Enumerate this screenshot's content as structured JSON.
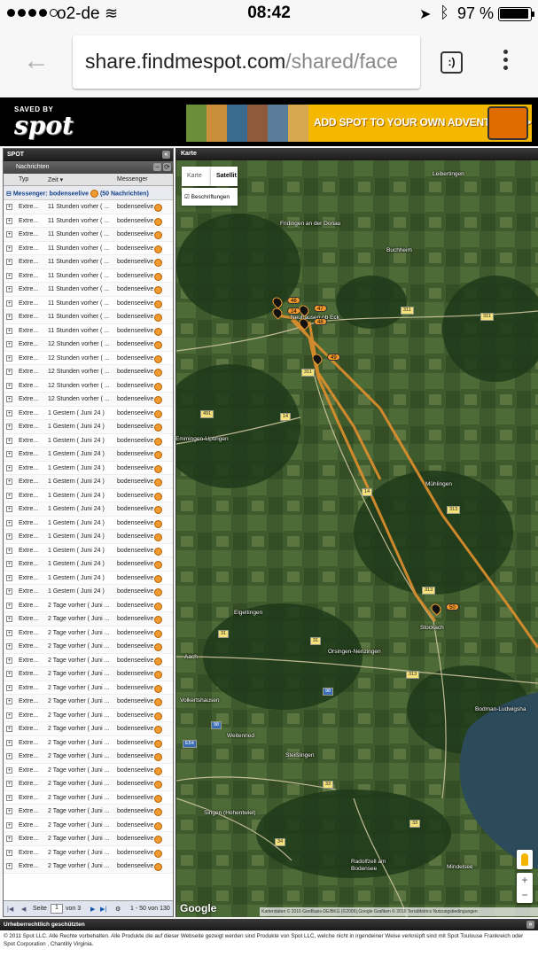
{
  "status_bar": {
    "carrier": "o2-de",
    "time": "08:42",
    "battery_percent": "97 %"
  },
  "browser": {
    "url_host": "share.findmespot.com",
    "url_path": "/shared/face",
    "reader_icon_label": ":)"
  },
  "header": {
    "logo_small": "SAVED BY",
    "logo_big": "spot",
    "ad_text": "ADD SPOT TO YOUR OWN ADVENTURES>>"
  },
  "panel": {
    "title": "SPOT",
    "subtitle": "Nachrichten",
    "columns": {
      "typ": "Typ",
      "zeit": "Zeit",
      "messenger": "Messenger"
    },
    "group_label": "Messenger: bodenseelive",
    "group_count": "(50 Nachrichten)",
    "rows": [
      {
        "typ": "Extre...",
        "zeit": "11 Stunden vorher ( ...",
        "messenger": "bodenseelive"
      },
      {
        "typ": "Extre...",
        "zeit": "11 Stunden vorher ( ...",
        "messenger": "bodenseelive"
      },
      {
        "typ": "Extre...",
        "zeit": "11 Stunden vorher ( ...",
        "messenger": "bodenseelive"
      },
      {
        "typ": "Extre...",
        "zeit": "11 Stunden vorher ( ...",
        "messenger": "bodenseelive"
      },
      {
        "typ": "Extre...",
        "zeit": "11 Stunden vorher ( ...",
        "messenger": "bodenseelive"
      },
      {
        "typ": "Extre...",
        "zeit": "11 Stunden vorher ( ...",
        "messenger": "bodenseelive"
      },
      {
        "typ": "Extre...",
        "zeit": "11 Stunden vorher ( ...",
        "messenger": "bodenseelive"
      },
      {
        "typ": "Extre...",
        "zeit": "11 Stunden vorher ( ...",
        "messenger": "bodenseelive"
      },
      {
        "typ": "Extre...",
        "zeit": "11 Stunden vorher ( ...",
        "messenger": "bodenseelive"
      },
      {
        "typ": "Extre...",
        "zeit": "11 Stunden vorher ( ...",
        "messenger": "bodenseelive"
      },
      {
        "typ": "Extre...",
        "zeit": "12 Stunden vorher ( ...",
        "messenger": "bodenseelive"
      },
      {
        "typ": "Extre...",
        "zeit": "12 Stunden vorher ( ...",
        "messenger": "bodenseelive"
      },
      {
        "typ": "Extre...",
        "zeit": "12 Stunden vorher ( ...",
        "messenger": "bodenseelive"
      },
      {
        "typ": "Extre...",
        "zeit": "12 Stunden vorher ( ...",
        "messenger": "bodenseelive"
      },
      {
        "typ": "Extre...",
        "zeit": "12 Stunden vorher ( ...",
        "messenger": "bodenseelive"
      },
      {
        "typ": "Extre...",
        "zeit": "1 Gestern ( Juni 24 )",
        "messenger": "bodenseelive"
      },
      {
        "typ": "Extre...",
        "zeit": "1 Gestern ( Juni 24 )",
        "messenger": "bodenseelive"
      },
      {
        "typ": "Extre...",
        "zeit": "1 Gestern ( Juni 24 )",
        "messenger": "bodenseelive"
      },
      {
        "typ": "Extre...",
        "zeit": "1 Gestern ( Juni 24 )",
        "messenger": "bodenseelive"
      },
      {
        "typ": "Extre...",
        "zeit": "1 Gestern ( Juni 24 )",
        "messenger": "bodenseelive"
      },
      {
        "typ": "Extre...",
        "zeit": "1 Gestern ( Juni 24 )",
        "messenger": "bodenseelive"
      },
      {
        "typ": "Extre...",
        "zeit": "1 Gestern ( Juni 24 )",
        "messenger": "bodenseelive"
      },
      {
        "typ": "Extre...",
        "zeit": "1 Gestern ( Juni 24 )",
        "messenger": "bodenseelive"
      },
      {
        "typ": "Extre...",
        "zeit": "1 Gestern ( Juni 24 )",
        "messenger": "bodenseelive"
      },
      {
        "typ": "Extre...",
        "zeit": "1 Gestern ( Juni 24 )",
        "messenger": "bodenseelive"
      },
      {
        "typ": "Extre...",
        "zeit": "1 Gestern ( Juni 24 )",
        "messenger": "bodenseelive"
      },
      {
        "typ": "Extre...",
        "zeit": "1 Gestern ( Juni 24 )",
        "messenger": "bodenseelive"
      },
      {
        "typ": "Extre...",
        "zeit": "1 Gestern ( Juni 24 )",
        "messenger": "bodenseelive"
      },
      {
        "typ": "Extre...",
        "zeit": "1 Gestern ( Juni 24 )",
        "messenger": "bodenseelive"
      },
      {
        "typ": "Extre...",
        "zeit": "2 Tage vorher ( Juni ...",
        "messenger": "bodenseelive"
      },
      {
        "typ": "Extre...",
        "zeit": "2 Tage vorher ( Juni ...",
        "messenger": "bodenseelive"
      },
      {
        "typ": "Extre...",
        "zeit": "2 Tage vorher ( Juni ...",
        "messenger": "bodenseelive"
      },
      {
        "typ": "Extre...",
        "zeit": "2 Tage vorher ( Juni ...",
        "messenger": "bodenseelive"
      },
      {
        "typ": "Extre...",
        "zeit": "2 Tage vorher ( Juni ...",
        "messenger": "bodenseelive"
      },
      {
        "typ": "Extre...",
        "zeit": "2 Tage vorher ( Juni ...",
        "messenger": "bodenseelive"
      },
      {
        "typ": "Extre...",
        "zeit": "2 Tage vorher ( Juni ...",
        "messenger": "bodenseelive"
      },
      {
        "typ": "Extre...",
        "zeit": "2 Tage vorher ( Juni ...",
        "messenger": "bodenseelive"
      },
      {
        "typ": "Extre...",
        "zeit": "2 Tage vorher ( Juni ...",
        "messenger": "bodenseelive"
      },
      {
        "typ": "Extre...",
        "zeit": "2 Tage vorher ( Juni ...",
        "messenger": "bodenseelive"
      },
      {
        "typ": "Extre...",
        "zeit": "2 Tage vorher ( Juni ...",
        "messenger": "bodenseelive"
      },
      {
        "typ": "Extre...",
        "zeit": "2 Tage vorher ( Juni ...",
        "messenger": "bodenseelive"
      },
      {
        "typ": "Extre...",
        "zeit": "2 Tage vorher ( Juni ...",
        "messenger": "bodenseelive"
      },
      {
        "typ": "Extre...",
        "zeit": "2 Tage vorher ( Juni ...",
        "messenger": "bodenseelive"
      },
      {
        "typ": "Extre...",
        "zeit": "2 Tage vorher ( Juni ...",
        "messenger": "bodenseelive"
      },
      {
        "typ": "Extre...",
        "zeit": "2 Tage vorher ( Juni ...",
        "messenger": "bodenseelive"
      },
      {
        "typ": "Extre...",
        "zeit": "2 Tage vorher ( Juni ...",
        "messenger": "bodenseelive"
      },
      {
        "typ": "Extre...",
        "zeit": "2 Tage vorher ( Juni ...",
        "messenger": "bodenseelive"
      },
      {
        "typ": "Extre...",
        "zeit": "2 Tage vorher ( Juni ...",
        "messenger": "bodenseelive"
      },
      {
        "typ": "Extre...",
        "zeit": "2 Tage vorher ( Juni ...",
        "messenger": "bodenseelive"
      }
    ],
    "pager": {
      "seite": "Seite",
      "page": "1",
      "von": "von 3",
      "range": "1 - 50 von 130"
    }
  },
  "map": {
    "title": "Karte",
    "type_karte": "Karte",
    "type_satellit": "Satellit",
    "beschriftungen": "Beschriftungen",
    "google": "Google",
    "attribution": "Kartendaten © 2016 GeoBasis-DE/BKG (©2009),Google Grafiken © 2016 TerraMetrics   Nutzungsbedingungen",
    "place_labels": [
      "Leibertingen",
      "Fridingen an der Donau",
      "Buchheim",
      "Neuhausen ob Eck",
      "Mühlingen",
      "Eigeltingen",
      "Stockach",
      "Orsingen-Nenzingen",
      "Aach",
      "Volkertshausen",
      "Bodman-Ludwigsha",
      "Steißlingen",
      "Singen (Hohentwiel)",
      "Radolfzell am Bodensee",
      "Weitenried",
      "Mindelsee",
      "Emmingen-Liptingen"
    ],
    "markers": [
      "46",
      "24",
      "47",
      "48",
      "49",
      "50"
    ],
    "roads": [
      "311",
      "311",
      "311",
      "14",
      "491",
      "14",
      "313",
      "313",
      "313",
      "31",
      "31",
      "98",
      "33",
      "33",
      "34",
      "98",
      "E54"
    ]
  },
  "footer": {
    "title": "Urheberrechtlich geschützten",
    "text": "© 2011 Spot LLC. Alle Rechte vorbehalten. Alle Produkte die auf dieser Webseite gezeigt werden sind Produkte von Spot LLC, welche nicht in irgendeiner Weise verknüpft sind mit Spot Toulouse Frankreich oder Spot Corporation , Chantilly Virginia."
  },
  "colors": {
    "track": "#e0902e",
    "marker": "#f39a2e",
    "header_bg": "#000000",
    "ad_bg": "#f4b800"
  }
}
